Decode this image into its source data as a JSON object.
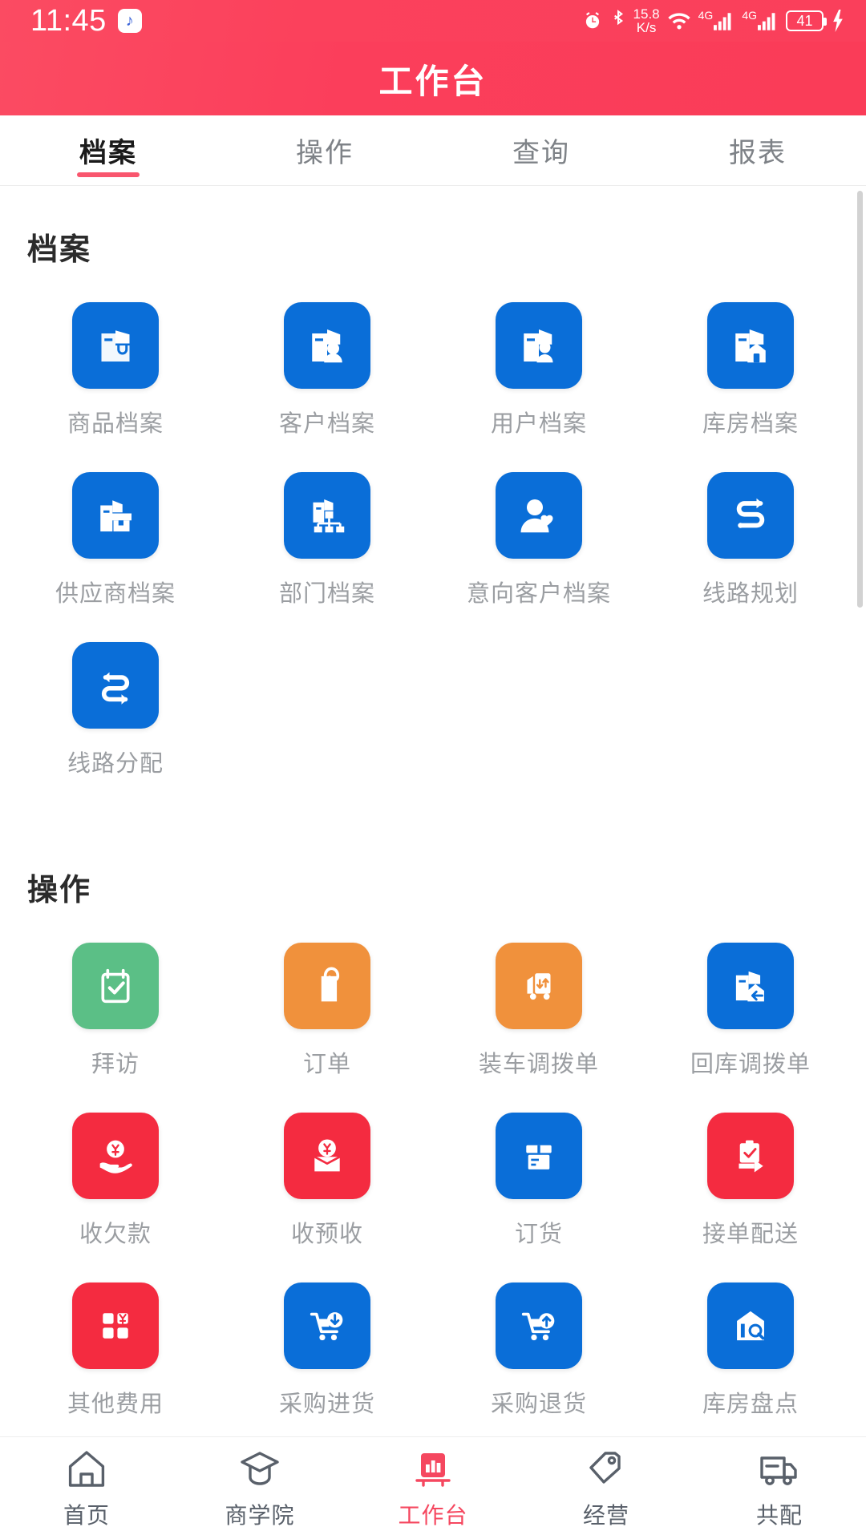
{
  "statusbar": {
    "time": "11:45",
    "music_icon": "music-note-icon",
    "alarm_icon": "alarm-clock-icon",
    "bluetooth_icon": "bluetooth-icon",
    "net_speed_value": "15.8",
    "net_speed_unit": "K/s",
    "wifi_icon": "wifi-icon",
    "sim1_label": "4G",
    "sim2_label": "4G",
    "battery_level": "41",
    "charging_icon": "lightning-bolt-icon"
  },
  "header": {
    "title": "工作台"
  },
  "tabs": [
    {
      "label": "档案",
      "active": true
    },
    {
      "label": "操作",
      "active": false
    },
    {
      "label": "查询",
      "active": false
    },
    {
      "label": "报表",
      "active": false
    }
  ],
  "colors": {
    "brand_red": "#fa3c58",
    "accent_pink": "#f9566e",
    "tile_blue": "#0a6ed8",
    "tile_green": "#5bbf86",
    "tile_orange": "#f0913c",
    "tile_red": "#f42b40",
    "label_gray": "#9b9ea2",
    "nav_gray": "#59606a"
  },
  "sections": [
    {
      "title": "档案",
      "items": [
        {
          "label": "商品档案",
          "icon": "product-file-icon",
          "color": "#0a6ed8"
        },
        {
          "label": "客户档案",
          "icon": "customer-file-icon",
          "color": "#0a6ed8"
        },
        {
          "label": "用户档案",
          "icon": "user-file-icon",
          "color": "#0a6ed8"
        },
        {
          "label": "库房档案",
          "icon": "warehouse-file-icon",
          "color": "#0a6ed8"
        },
        {
          "label": "供应商档案",
          "icon": "supplier-file-icon",
          "color": "#0a6ed8"
        },
        {
          "label": "部门档案",
          "icon": "department-file-icon",
          "color": "#0a6ed8"
        },
        {
          "label": "意向客户档案",
          "icon": "prospect-customer-icon",
          "color": "#0a6ed8"
        },
        {
          "label": "线路规划",
          "icon": "route-plan-icon",
          "color": "#0a6ed8"
        },
        {
          "label": "线路分配",
          "icon": "route-assign-icon",
          "color": "#0a6ed8"
        }
      ]
    },
    {
      "title": "操作",
      "items": [
        {
          "label": "拜访",
          "icon": "visit-checklist-icon",
          "color": "#5bbf86"
        },
        {
          "label": "订单",
          "icon": "order-document-icon",
          "color": "#f0913c"
        },
        {
          "label": "装车调拨单",
          "icon": "load-truck-transfer-icon",
          "color": "#f0913c"
        },
        {
          "label": "回库调拨单",
          "icon": "return-warehouse-transfer-icon",
          "color": "#0a6ed8"
        },
        {
          "label": "收欠款",
          "icon": "collect-debt-icon",
          "color": "#f42b40"
        },
        {
          "label": "收预收",
          "icon": "collect-prepay-icon",
          "color": "#f42b40"
        },
        {
          "label": "订货",
          "icon": "goods-box-icon",
          "color": "#0a6ed8"
        },
        {
          "label": "接单配送",
          "icon": "order-delivery-icon",
          "color": "#f42b40"
        },
        {
          "label": "其他费用",
          "icon": "other-fee-icon",
          "color": "#f42b40"
        },
        {
          "label": "采购进货",
          "icon": "purchase-in-cart-icon",
          "color": "#0a6ed8"
        },
        {
          "label": "采购退货",
          "icon": "purchase-return-cart-icon",
          "color": "#0a6ed8"
        },
        {
          "label": "库房盘点",
          "icon": "warehouse-audit-icon",
          "color": "#0a6ed8"
        }
      ],
      "partial_row_colors": [
        "#f0913c",
        "#f0913c",
        "#f0913c",
        "#0a6ed8"
      ]
    }
  ],
  "bottomnav": [
    {
      "label": "首页",
      "icon": "home-icon",
      "active": false
    },
    {
      "label": "商学院",
      "icon": "graduation-cap-icon",
      "active": false
    },
    {
      "label": "工作台",
      "icon": "bar-chart-icon",
      "active": true
    },
    {
      "label": "经营",
      "icon": "price-tag-icon",
      "active": false
    },
    {
      "label": "共配",
      "icon": "truck-icon",
      "active": false
    }
  ]
}
